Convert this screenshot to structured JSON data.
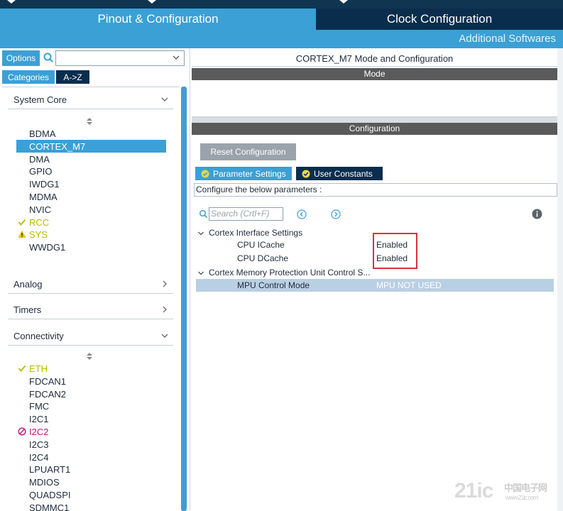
{
  "tabs": {
    "pinout": "Pinout & Configuration",
    "clock": "Clock Configuration",
    "additional": "Additional Softwares"
  },
  "left": {
    "options_label": "Options",
    "search_value": "",
    "categories_label": "Categories",
    "az_label": "A->Z",
    "sections": {
      "system_core": "System Core",
      "analog": "Analog",
      "timers": "Timers",
      "connectivity": "Connectivity"
    },
    "system_core_items": [
      {
        "label": "BDMA",
        "status": "none"
      },
      {
        "label": "CORTEX_M7",
        "status": "selected"
      },
      {
        "label": "DMA",
        "status": "none"
      },
      {
        "label": "GPIO",
        "status": "none"
      },
      {
        "label": "IWDG1",
        "status": "none"
      },
      {
        "label": "MDMA",
        "status": "none"
      },
      {
        "label": "NVIC",
        "status": "none"
      },
      {
        "label": "RCC",
        "status": "check"
      },
      {
        "label": "SYS",
        "status": "warning"
      },
      {
        "label": "WWDG1",
        "status": "none"
      }
    ],
    "connectivity_items": [
      {
        "label": "ETH",
        "status": "check"
      },
      {
        "label": "FDCAN1",
        "status": "none"
      },
      {
        "label": "FDCAN2",
        "status": "none"
      },
      {
        "label": "FMC",
        "status": "none"
      },
      {
        "label": "I2C1",
        "status": "none"
      },
      {
        "label": "I2C2",
        "status": "blocked"
      },
      {
        "label": "I2C3",
        "status": "none"
      },
      {
        "label": "I2C4",
        "status": "none"
      },
      {
        "label": "LPUART1",
        "status": "none"
      },
      {
        "label": "MDIOS",
        "status": "none"
      },
      {
        "label": "QUADSPI",
        "status": "none"
      },
      {
        "label": "SDMMC1",
        "status": "none"
      }
    ]
  },
  "right": {
    "title": "CORTEX_M7 Mode and Configuration",
    "mode_label": "Mode",
    "config_label": "Configuration",
    "reset_label": "Reset Configuration",
    "param_tab": "Parameter Settings",
    "user_tab": "User Constants",
    "configure_text": "Configure the below parameters :",
    "search_placeholder": "Search (Crtl+F)",
    "groups": {
      "interface": "Cortex Interface Settings",
      "mpu": "Cortex Memory Protection Unit Control S..."
    },
    "params": {
      "icache_name": "CPU ICache",
      "icache_value": "Enabled",
      "dcache_name": "CPU DCache",
      "dcache_value": "Enabled",
      "mpu_name": "MPU Control Mode",
      "mpu_value": "MPU NOT USED"
    }
  },
  "watermark": {
    "main": "21ic",
    "cn": "中国电子网",
    "url": "www.21ic.com"
  },
  "colors": {
    "accent": "#3ba0d5",
    "dark": "#0b2d4d",
    "warning": "#b9b900",
    "error": "#c0147a",
    "highlight": "#d6333a"
  }
}
